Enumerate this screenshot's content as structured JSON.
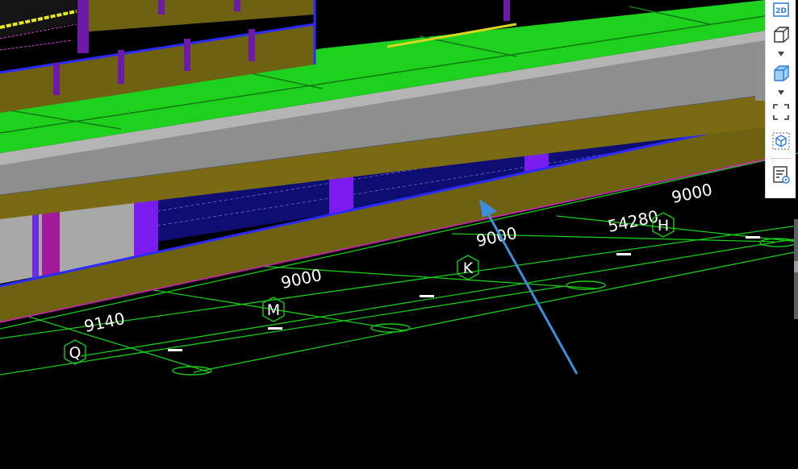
{
  "viewport": {
    "dimensions": [
      "9140",
      "9000",
      "9000",
      "54280",
      "9000"
    ],
    "axes": [
      "Q",
      "M",
      "K",
      "H"
    ]
  },
  "toolbar": {
    "items": [
      {
        "label": "2D",
        "icon": "2d-view-icon"
      },
      {
        "icon": "cube-outline-icon"
      },
      {
        "icon": "cube-filled-icon"
      },
      {
        "icon": "fit-view-icon"
      },
      {
        "icon": "select-box-icon"
      },
      {
        "icon": "view-settings-icon"
      }
    ]
  },
  "colors": {
    "background": "#000000",
    "slab_green": "#1fd11f",
    "beam_olive": "#6e6112",
    "beam_gray": "#8e8e8e",
    "column_purple": "#7a1cf0",
    "floor_navy": "#0e0e72",
    "grid_green": "#18cc18",
    "annotation_arrow": "#3c8fdc",
    "toolbar_icon": "#2b7ad8"
  }
}
